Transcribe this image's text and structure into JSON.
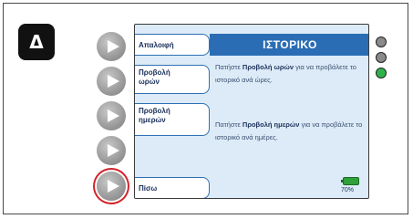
{
  "step_badge": "Δ",
  "softkeys": {
    "cancel": "Απαλοιφή",
    "hours_line1": "Προβολή",
    "hours_line2": "ωρών",
    "days_line1": "Προβολή",
    "days_line2": "ημερών",
    "back": "Πίσω"
  },
  "screen": {
    "title": "ΙΣΤΟΡΙΚΟ",
    "hours_msg_pre": "Πατήστε ",
    "hours_msg_bold": "Προβολή ωρών",
    "hours_msg_post": " για να προβάλετε το ιστορικό ανά ώρες.",
    "days_msg_pre": "Πατήστε ",
    "days_msg_bold": "Προβολή ημερών",
    "days_msg_post": " για να προβάλετε το ιστορικό ανά ημέρες.",
    "battery_percent": "70%",
    "battery_level": 0.7
  },
  "indicators": {
    "led_colors": [
      "#8a8a8a",
      "#8a8a8a",
      "#2fb24a"
    ]
  },
  "colors": {
    "highlight": "#d2232a",
    "header": "#2a6db5",
    "screen_bg": "#dcebf7"
  }
}
